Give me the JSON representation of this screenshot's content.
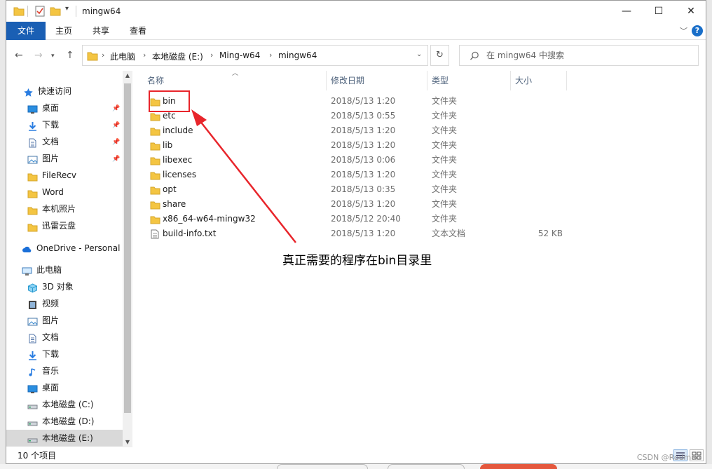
{
  "window": {
    "title": "mingw64",
    "controls": {
      "minimize": "—",
      "maximize": "☐",
      "close": "✕"
    }
  },
  "ribbon": {
    "tabs": [
      {
        "label": "文件"
      },
      {
        "label": "主页"
      },
      {
        "label": "共享"
      },
      {
        "label": "查看"
      }
    ],
    "help": "?"
  },
  "address": {
    "crumbs": [
      "此电脑",
      "本地磁盘 (E:)",
      "Ming-w64",
      "mingw64"
    ]
  },
  "search": {
    "placeholder": "在 mingw64 中搜索"
  },
  "sidebar": {
    "items": [
      {
        "label": "快速访问",
        "icon": "star-icon",
        "pinned": false
      },
      {
        "label": "桌面",
        "icon": "desktop-icon",
        "pinned": true
      },
      {
        "label": "下载",
        "icon": "download-icon",
        "pinned": true
      },
      {
        "label": "文档",
        "icon": "document-icon",
        "pinned": true
      },
      {
        "label": "图片",
        "icon": "picture-icon",
        "pinned": true
      },
      {
        "label": "FileRecv",
        "icon": "folder-icon",
        "pinned": false
      },
      {
        "label": "Word",
        "icon": "folder-icon",
        "pinned": false
      },
      {
        "label": "本机照片",
        "icon": "folder-icon",
        "pinned": false
      },
      {
        "label": "迅雷云盘",
        "icon": "folder-icon",
        "pinned": false
      },
      {
        "label": "OneDrive - Personal",
        "icon": "cloud-icon",
        "pinned": false
      },
      {
        "label": "此电脑",
        "icon": "computer-icon",
        "pinned": false
      },
      {
        "label": "3D 对象",
        "icon": "cube-icon",
        "pinned": false
      },
      {
        "label": "视频",
        "icon": "video-icon",
        "pinned": false
      },
      {
        "label": "图片",
        "icon": "picture-icon",
        "pinned": false
      },
      {
        "label": "文档",
        "icon": "document-icon",
        "pinned": false
      },
      {
        "label": "下载",
        "icon": "download-icon",
        "pinned": false
      },
      {
        "label": "音乐",
        "icon": "music-icon",
        "pinned": false
      },
      {
        "label": "桌面",
        "icon": "desktop-icon",
        "pinned": false
      },
      {
        "label": "本地磁盘 (C:)",
        "icon": "drive-icon",
        "pinned": false
      },
      {
        "label": "本地磁盘 (D:)",
        "icon": "drive-icon",
        "pinned": false
      },
      {
        "label": "本地磁盘 (E:)",
        "icon": "drive-icon",
        "pinned": false
      }
    ]
  },
  "columns": {
    "name": "名称",
    "date": "修改日期",
    "type": "类型",
    "size": "大小"
  },
  "files": [
    {
      "name": "bin",
      "date": "2018/5/13 1:20",
      "type": "文件夹",
      "size": "",
      "kind": "folder"
    },
    {
      "name": "etc",
      "date": "2018/5/13 0:55",
      "type": "文件夹",
      "size": "",
      "kind": "folder"
    },
    {
      "name": "include",
      "date": "2018/5/13 1:20",
      "type": "文件夹",
      "size": "",
      "kind": "folder"
    },
    {
      "name": "lib",
      "date": "2018/5/13 1:20",
      "type": "文件夹",
      "size": "",
      "kind": "folder"
    },
    {
      "name": "libexec",
      "date": "2018/5/13 0:06",
      "type": "文件夹",
      "size": "",
      "kind": "folder"
    },
    {
      "name": "licenses",
      "date": "2018/5/13 1:20",
      "type": "文件夹",
      "size": "",
      "kind": "folder"
    },
    {
      "name": "opt",
      "date": "2018/5/13 0:35",
      "type": "文件夹",
      "size": "",
      "kind": "folder"
    },
    {
      "name": "share",
      "date": "2018/5/13 1:20",
      "type": "文件夹",
      "size": "",
      "kind": "folder"
    },
    {
      "name": "x86_64-w64-mingw32",
      "date": "2018/5/12 20:40",
      "type": "文件夹",
      "size": "",
      "kind": "folder"
    },
    {
      "name": "build-info.txt",
      "date": "2018/5/13 1:20",
      "type": "文本文档",
      "size": "52 KB",
      "kind": "file"
    }
  ],
  "annotation": {
    "text": "真正需要的程序在bin目录里"
  },
  "status": {
    "count": "10 个项目"
  },
  "watermark": "CSDN @Rodmad",
  "colors": {
    "accent": "#1a5fb4",
    "folder": "#f4c542",
    "highlight": "#e8252b"
  }
}
